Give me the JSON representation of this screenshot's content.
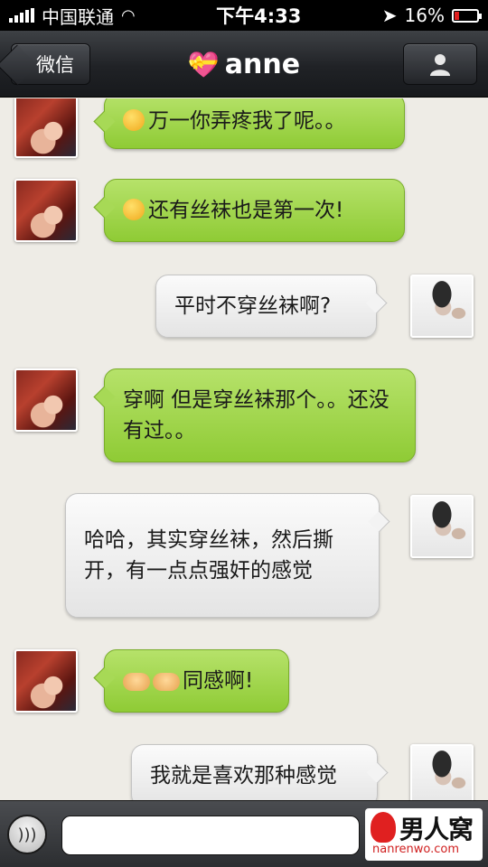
{
  "status_bar": {
    "carrier": "中国联通",
    "time": "下午4:33",
    "battery": "16%"
  },
  "nav": {
    "back_label": "微信",
    "title": "anne",
    "title_icon": "heart-gift-icon"
  },
  "messages": [
    {
      "sender": "anne",
      "emoji": "embarrassed-face",
      "text": "万一你弄疼我了呢。。"
    },
    {
      "sender": "anne",
      "emoji": "shy-face",
      "text": "还有丝袜也是第一次!"
    },
    {
      "sender": "me",
      "text": "平时不穿丝袜啊?"
    },
    {
      "sender": "anne",
      "text": "穿啊 但是穿丝袜那个。。还没有过。。"
    },
    {
      "sender": "me",
      "text": "哈哈，其实穿丝袜，然后撕开，有一点点强奸的感觉"
    },
    {
      "sender": "anne",
      "emoji": "handshake x2",
      "text": "同感啊!"
    },
    {
      "sender": "me",
      "text": "我就是喜欢那种感觉"
    }
  ],
  "input_bar": {
    "voice_icon": "voice-icon",
    "input_value": ""
  },
  "watermark": {
    "title": "男人窝",
    "url": "nanrenwo.com"
  }
}
